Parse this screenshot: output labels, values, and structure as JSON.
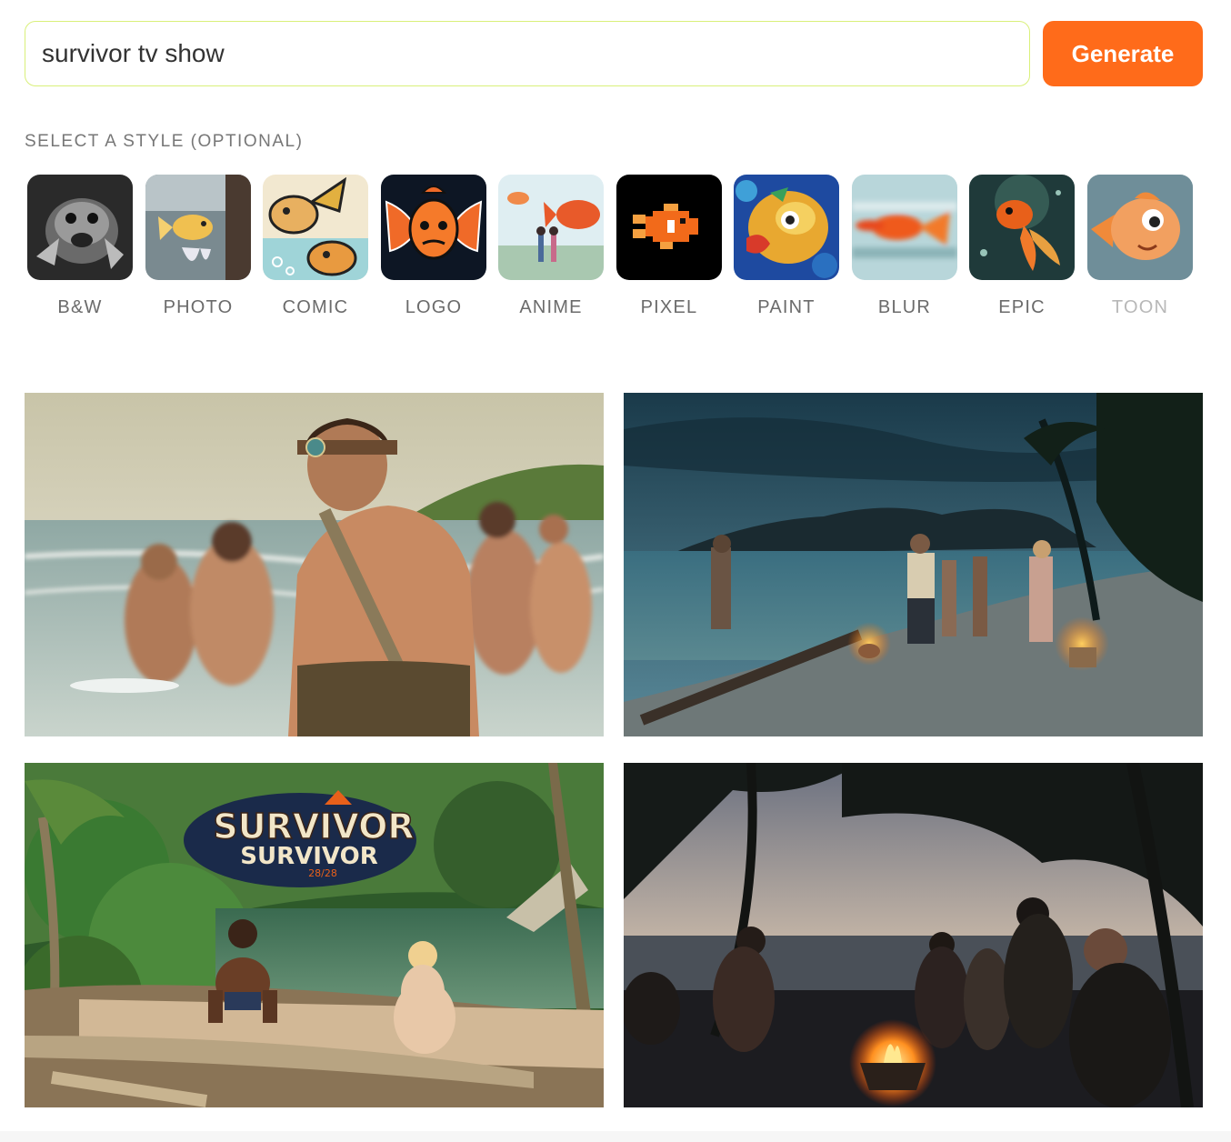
{
  "prompt": {
    "value": "survivor tv show"
  },
  "generate_label": "Generate",
  "style_heading": "SELECT A STYLE (OPTIONAL)",
  "styles": [
    {
      "label": "B&W",
      "icon": "bw-fish-thumbnail"
    },
    {
      "label": "PHOTO",
      "icon": "photo-fish-thumbnail"
    },
    {
      "label": "COMIC",
      "icon": "comic-fish-thumbnail"
    },
    {
      "label": "LOGO",
      "icon": "logo-fish-thumbnail"
    },
    {
      "label": "ANIME",
      "icon": "anime-fish-thumbnail"
    },
    {
      "label": "PIXEL",
      "icon": "pixel-fish-thumbnail"
    },
    {
      "label": "PAINT",
      "icon": "paint-fish-thumbnail"
    },
    {
      "label": "BLUR",
      "icon": "blur-fish-thumbnail"
    },
    {
      "label": "EPIC",
      "icon": "epic-fish-thumbnail"
    },
    {
      "label": "TOON",
      "icon": "toon-fish-thumbnail"
    }
  ],
  "results": [
    {
      "name": "castaways-wading-image"
    },
    {
      "name": "beach-campfire-dusk-image"
    },
    {
      "name": "survivor-logo-lagoon-image",
      "logo_text_line1": "SURVIVOR",
      "logo_text_line2": "SURVIVOR",
      "logo_text_line3": "28/28"
    },
    {
      "name": "campfire-night-image"
    }
  ],
  "colors": {
    "accent": "#ff6b1a",
    "input_border": "#d9f07a",
    "label": "#6b6b6b"
  }
}
